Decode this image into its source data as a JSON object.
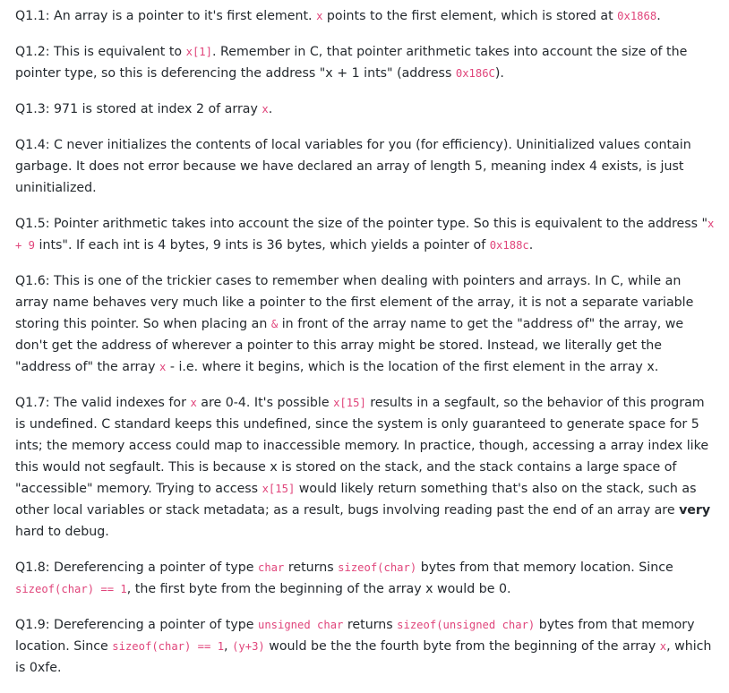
{
  "answers": [
    {
      "id": "Q1.1",
      "segments": [
        {
          "t": "text",
          "v": "Q1.1: An array is a pointer to it's first element. "
        },
        {
          "t": "code",
          "v": "x"
        },
        {
          "t": "text",
          "v": " points to the first element, which is stored at "
        },
        {
          "t": "code",
          "v": "0x1868"
        },
        {
          "t": "text",
          "v": "."
        }
      ]
    },
    {
      "id": "Q1.2",
      "segments": [
        {
          "t": "text",
          "v": "Q1.2: This is equivalent to "
        },
        {
          "t": "code",
          "v": "x[1]"
        },
        {
          "t": "text",
          "v": ". Remember in C, that pointer arithmetic takes into account the size of the pointer type, so this is deferencing the address \"x + 1 ints\" (address "
        },
        {
          "t": "code",
          "v": "0x186C"
        },
        {
          "t": "text",
          "v": ")."
        }
      ]
    },
    {
      "id": "Q1.3",
      "segments": [
        {
          "t": "text",
          "v": "Q1.3: 971 is stored at index 2 of array "
        },
        {
          "t": "code",
          "v": "x"
        },
        {
          "t": "text",
          "v": "."
        }
      ]
    },
    {
      "id": "Q1.4",
      "segments": [
        {
          "t": "text",
          "v": "Q1.4: C never initializes the contents of local variables for you (for efficiency). Uninitialized values contain garbage. It does not error because we have declared an array of length 5, meaning index 4 exists, is just uninitialized."
        }
      ]
    },
    {
      "id": "Q1.5",
      "segments": [
        {
          "t": "text",
          "v": "Q1.5: Pointer arithmetic takes into account the size of the pointer type. So this is equivalent to the address \""
        },
        {
          "t": "code",
          "v": "x + 9"
        },
        {
          "t": "text",
          "v": " ints\". If each int is 4 bytes, 9 ints is 36 bytes, which yields a pointer of "
        },
        {
          "t": "code",
          "v": "0x188c"
        },
        {
          "t": "text",
          "v": "."
        }
      ]
    },
    {
      "id": "Q1.6",
      "segments": [
        {
          "t": "text",
          "v": "Q1.6: This is one of the trickier cases to remember when dealing with pointers and arrays. In C, while an array name behaves very much like a pointer to the first element of the array, it is not a separate variable storing this pointer. So when placing an "
        },
        {
          "t": "code",
          "v": "&"
        },
        {
          "t": "text",
          "v": " in front of the array name to get the \"address of\" the array, we don't get the address of wherever a pointer to this array might be stored. Instead, we literally get the \"address of\" the array "
        },
        {
          "t": "code",
          "v": "x"
        },
        {
          "t": "text",
          "v": " - i.e. where it begins, which is the location of the first element in the array x."
        }
      ]
    },
    {
      "id": "Q1.7",
      "segments": [
        {
          "t": "text",
          "v": "Q1.7: The valid indexes for "
        },
        {
          "t": "code",
          "v": "x"
        },
        {
          "t": "text",
          "v": " are 0-4. It's possible "
        },
        {
          "t": "code",
          "v": "x[15]"
        },
        {
          "t": "text",
          "v": " results in a segfault, so the behavior of this program is undefined. C standard keeps this undefined, since the system is only guaranteed to generate space for 5 ints; the memory access could map to inaccessible memory. In practice, though, accessing a array index like this would not segfault. This is because x is stored on the stack, and the stack contains a large space of \"accessible\" memory. Trying to access "
        },
        {
          "t": "code",
          "v": "x[15]"
        },
        {
          "t": "text",
          "v": " would likely return something that's also on the stack, such as other local variables or stack metadata; as a result, bugs involving reading past the end of an array are "
        },
        {
          "t": "bold",
          "v": "very"
        },
        {
          "t": "text",
          "v": " hard to debug."
        }
      ]
    },
    {
      "id": "Q1.8",
      "segments": [
        {
          "t": "text",
          "v": "Q1.8: Dereferencing a pointer of type "
        },
        {
          "t": "code",
          "v": "char"
        },
        {
          "t": "text",
          "v": " returns "
        },
        {
          "t": "code",
          "v": "sizeof(char)"
        },
        {
          "t": "text",
          "v": " bytes from that memory location. Since "
        },
        {
          "t": "code",
          "v": "sizeof(char) == 1"
        },
        {
          "t": "text",
          "v": ", the first byte from the beginning of the array x would be 0."
        }
      ]
    },
    {
      "id": "Q1.9",
      "segments": [
        {
          "t": "text",
          "v": "Q1.9: Dereferencing a pointer of type "
        },
        {
          "t": "code",
          "v": "unsigned char"
        },
        {
          "t": "text",
          "v": " returns "
        },
        {
          "t": "code",
          "v": "sizeof(unsigned char)"
        },
        {
          "t": "text",
          "v": " bytes from that memory location. Since "
        },
        {
          "t": "code",
          "v": "sizeof(char) == 1"
        },
        {
          "t": "text",
          "v": ", "
        },
        {
          "t": "code",
          "v": "(y+3)"
        },
        {
          "t": "text",
          "v": " would be the the fourth byte from the beginning of the array "
        },
        {
          "t": "code",
          "v": "x"
        },
        {
          "t": "text",
          "v": ", which is 0xfe."
        }
      ]
    }
  ]
}
